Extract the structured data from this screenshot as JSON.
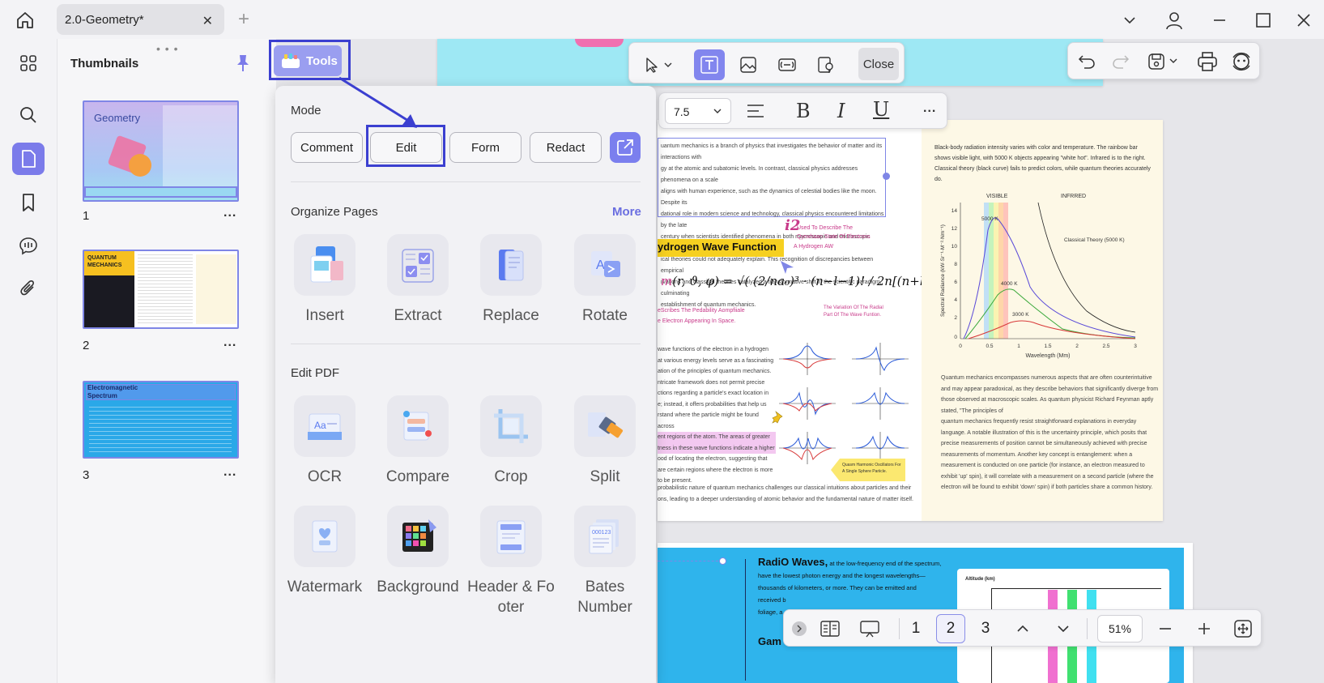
{
  "tab": {
    "title": "2.0-Geometry*"
  },
  "thumbnails": {
    "title": "Thumbnails",
    "pages": [
      {
        "num": "1",
        "label": "Geometry"
      },
      {
        "num": "2",
        "label": "QUANTUM MECHANICS"
      },
      {
        "num": "3",
        "label": "Electromagnetic Spectrum"
      }
    ],
    "more": "..."
  },
  "tools_button": {
    "label": "Tools"
  },
  "toolbar": {
    "close": "Close"
  },
  "format_bar": {
    "font_size": "7.5",
    "more": "..."
  },
  "popup": {
    "mode_label": "Mode",
    "modes": [
      "Comment",
      "Edit",
      "Form",
      "Redact"
    ],
    "organize_label": "Organize Pages",
    "more_label": "More",
    "organize_tools": [
      "Insert",
      "Extract",
      "Replace",
      "Rotate"
    ],
    "edit_label": "Edit PDF",
    "edit_tools": [
      "OCR",
      "Compare",
      "Crop",
      "Split"
    ],
    "extra_tools": [
      "Watermark",
      "Background",
      "Header & Fo oter",
      "Bates Number"
    ]
  },
  "doc": {
    "p2_heading": "ydrogen Wave Function",
    "annot_i2": "i2",
    "annot_i2_text": "Used To Describe The Qyrwhaan State Of Electrons",
    "annot_hyd": "A Hydrogen AW",
    "annot_prob": "eScribes The Pedability Aompfiiale",
    "annot_prob2": "e Electron Appearing In Space.",
    "annot_radial": "The Variation Of The Radial Part Of The Wave Funtion.",
    "note_label": "Quasm Harmonic Oscillators For A Single Sphere Pariicle.",
    "p2_text_lines": [
      "uantum mechanics is a branch of physics that investigates the behavior of matter and its interactions with",
      "gy at the atomic and subatomic levels. In contrast, classical physics addresses phenomena on a scale",
      "aligns with human experience, such as the dynamics of celestial bodies like the moon. Despite its",
      "dational role in modern science and technology, classical physics encountered limitations by the late",
      "century when scientists identified phenomena in both macroscopic and microscopic realms that",
      "ical theories could not adequately explain. This recognition of discrepancies between empirical",
      "rvations and classical theories catalyzed a transformative shift in the scientific paradigm, culminating",
      "establishment of quantum mechanics."
    ],
    "p2_lower_lines": [
      "wave functions of the electron in a hydrogen",
      "at various energy levels serve as a fascinating",
      "ation of the principles of quantum mechanics.",
      "ntricate framework does not permit precise",
      "ctions regarding a particle's exact location in",
      "e; instead, it offers probabilities that help us",
      "rstand where the particle might be found across",
      "ent regions of the atom. The areas of greater",
      "tness in these wave functions indicate a higher",
      "ood of locating the electron, suggesting that",
      "are certain regions where the electron is more",
      "to be present."
    ],
    "p2_bottom": "probabilistic nature of quantum mechanics challenges our classical intuitions about particles and their",
    "p2_bottom2": "ons, leading to a deeper understanding of atomic behavior and the fundamental nature of matter itself.",
    "right_top": "Black-body radiation intensity varies with color and temperature. The rainbow bar shows visible light, with 5000 K objects appearing \"white hot\". Infrared is to the right. Classical theory (black curve) fails to predict colors, while quantum theories accurately do.",
    "right_bottom": [
      "Quantum mechanics encompasses numerous aspects that are often counterintuitive",
      "and may appear paradoxical, as they describe behaviors that significantly diverge from",
      "those observed at macroscopic scales. As quantum physicist Richard Feynman aptly",
      "stated, \"The principles of",
      "quantum mechanics frequently resist straightforward explanations in everyday",
      "language. A notable illustration of this is the uncertainty principle, which posits that",
      "precise measurements of position cannot be simultaneously achieved with precise",
      "measurements of momentum. Another key concept is entanglement: when a",
      "measurement is conducted on one particle (for instance, an electron measured to",
      "exhibit 'up' spin), it will correlate with a measurement on a second particle (where the",
      "electron will be found to exhibit 'down' spin) if both particles share a common history."
    ],
    "p3_heading": "RadiO Waves,",
    "p3_text": [
      "at the low-frequency end of the spectrum,",
      "have the lowest photon energy and the longest wavelengths—",
      "thousands of kilometers, or more. They can be emitted and",
      "received b",
      "foliage, a"
    ],
    "p3_gam": "Gam",
    "p3_chart_title": "Altitude (km)"
  },
  "bb_chart": {
    "visible_label": "VISIBLE",
    "infrared_label": "INFRRED",
    "classical_label": "Classical Theory (5000 K)",
    "series": [
      "5000 K",
      "4000 K",
      "3000 K"
    ],
    "ylabel": "Spectral Radiance (kW·Sr⁻¹·M⁻²·Nm⁻¹)",
    "xlabel": "Wavelength (Mm)",
    "yticks": [
      "14",
      "12",
      "10",
      "8",
      "6",
      "4",
      "2",
      "0"
    ],
    "xticks": [
      "0",
      "0.5",
      "1",
      "1.5",
      "2",
      "2.5",
      "3"
    ]
  },
  "bottom_bar": {
    "pages": [
      "1",
      "2",
      "3"
    ],
    "zoom": "51%"
  }
}
